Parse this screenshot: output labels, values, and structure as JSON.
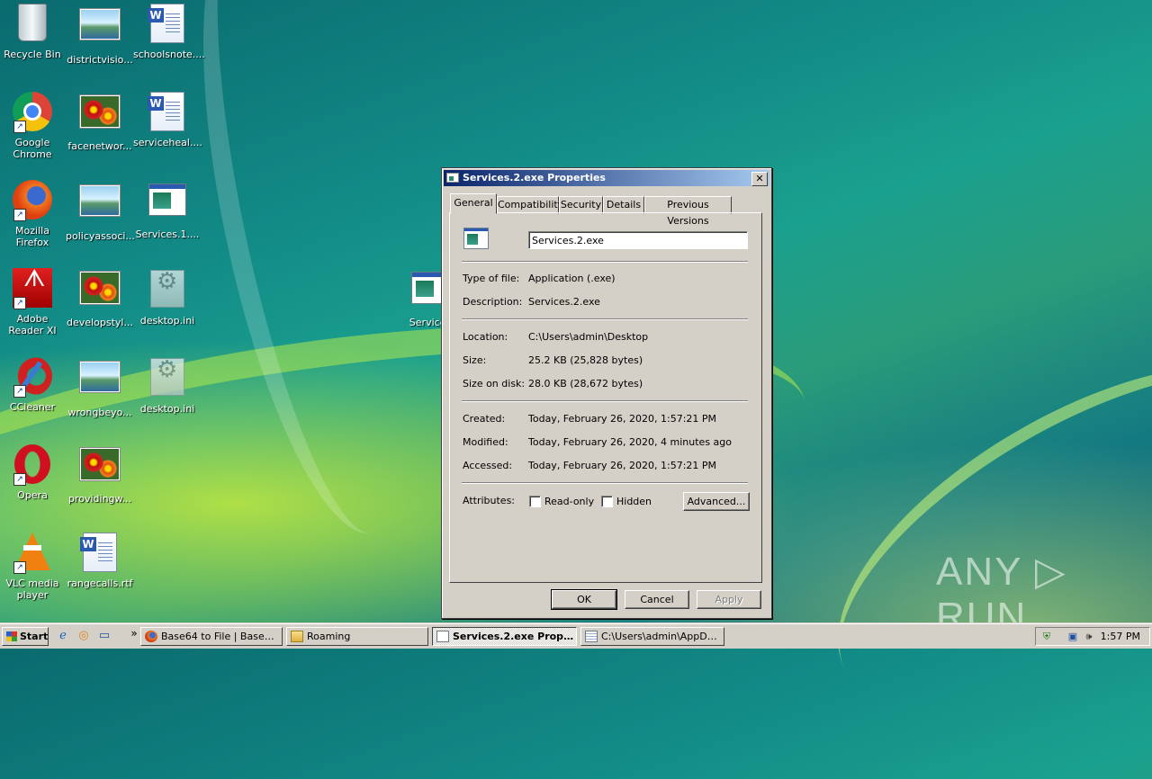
{
  "desktop": {
    "icons": [
      {
        "label": "Recycle Bin",
        "icon": "recycle-bin-icon"
      },
      {
        "label": "districtvisio...",
        "icon": "image-file-icon"
      },
      {
        "label": "schoolsnote....",
        "icon": "word-document-icon"
      },
      {
        "label": "Google Chrome",
        "icon": "chrome-icon"
      },
      {
        "label": "facenetwor...",
        "icon": "image-file-icon"
      },
      {
        "label": "serviceheal....",
        "icon": "word-document-icon"
      },
      {
        "label": "Mozilla Firefox",
        "icon": "firefox-icon"
      },
      {
        "label": "policyassoci...",
        "icon": "image-file-icon"
      },
      {
        "label": "Services.1....",
        "icon": "exe-file-icon"
      },
      {
        "label": "Adobe Reader XI",
        "icon": "adobe-reader-icon"
      },
      {
        "label": "developstyl...",
        "icon": "image-file-icon"
      },
      {
        "label": "desktop.ini",
        "icon": "settings-file-icon"
      },
      {
        "label": "CCleaner",
        "icon": "ccleaner-icon"
      },
      {
        "label": "wrongbeyo...",
        "icon": "image-file-icon"
      },
      {
        "label": "desktop.ini",
        "icon": "settings-file-icon"
      },
      {
        "label": "Opera",
        "icon": "opera-icon"
      },
      {
        "label": "providingw...",
        "icon": "image-file-icon"
      },
      {
        "label": "VLC media player",
        "icon": "vlc-icon"
      },
      {
        "label": "rangecalls.rtf",
        "icon": "word-document-icon"
      },
      {
        "label": "Services",
        "icon": "exe-file-icon"
      }
    ]
  },
  "dialog": {
    "title": "Services.2.exe Properties",
    "close_glyph": "✕",
    "tabs": [
      "General",
      "Compatibility",
      "Security",
      "Details",
      "Previous Versions"
    ],
    "active_tab": "General",
    "file_name": "Services.2.exe",
    "fields": {
      "type_label": "Type of file:",
      "type_value": "Application (.exe)",
      "description_label": "Description:",
      "description_value": "Services.2.exe",
      "location_label": "Location:",
      "location_value": "C:\\Users\\admin\\Desktop",
      "size_label": "Size:",
      "size_value": "25.2 KB (25,828 bytes)",
      "size_on_disk_label": "Size on disk:",
      "size_on_disk_value": "28.0 KB (28,672 bytes)",
      "created_label": "Created:",
      "created_value": "Today, February 26, 2020, 1:57:21 PM",
      "modified_label": "Modified:",
      "modified_value": "Today, February 26, 2020, 4 minutes ago",
      "accessed_label": "Accessed:",
      "accessed_value": "Today, February 26, 2020, 1:57:21 PM",
      "attributes_label": "Attributes:"
    },
    "attributes": {
      "readonly_label": "Read-only",
      "readonly_checked": false,
      "hidden_label": "Hidden",
      "hidden_checked": false
    },
    "advanced_button": "Advanced...",
    "ok_button": "OK",
    "cancel_button": "Cancel",
    "apply_button": "Apply"
  },
  "taskbar": {
    "start_label": "Start",
    "overflow_glyph": "»",
    "tasks": [
      {
        "label": "Base64 to File | Base64 ...",
        "icon": "firefox-icon",
        "active": false
      },
      {
        "label": "Roaming",
        "icon": "folder-icon",
        "active": false
      },
      {
        "label": "Services.2.exe Proper...",
        "icon": "properties-icon",
        "active": true
      },
      {
        "label": "C:\\Users\\admin\\AppData...",
        "icon": "notepad-icon",
        "active": false
      }
    ],
    "clock": "1:57 PM"
  },
  "watermark": "ANY ▷ RUN"
}
